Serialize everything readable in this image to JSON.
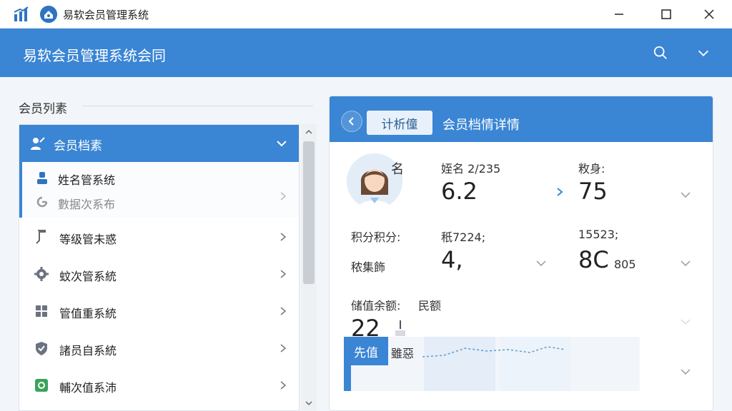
{
  "window": {
    "title": "易软会员管理系统"
  },
  "header": {
    "brand": "易软会员管理系统会同"
  },
  "sidebar": {
    "section_title": "会员列素",
    "group": {
      "label": "会员档素"
    },
    "sub_items": [
      {
        "label": "姓名管系统"
      },
      {
        "label": "數据次系布"
      }
    ],
    "items": [
      {
        "label": "等级管未惑"
      },
      {
        "label": "蚊次管系統"
      },
      {
        "label": "管值重系統"
      },
      {
        "label": "諸员自系統"
      },
      {
        "label": "輔次值系沛"
      }
    ]
  },
  "detail": {
    "tag": "计析僮",
    "title": "会员档情详情",
    "name_label": "名",
    "field1_label": "姪名 2/235",
    "field1_value": "6.2",
    "field2_label": "敉身:",
    "field2_value": "75",
    "points_label": "积分积分:",
    "points_label2": "秾集飾",
    "field3_label": "秖7224;",
    "field3_value": "4,",
    "field4_label": "15523;",
    "field4_value": "8C",
    "field4_suffix": "805",
    "balance_label": "储值余额:",
    "balance_label2": "民额",
    "balance_value": "22",
    "chart_tab": "先值",
    "chart_sub": "雖惡"
  },
  "colors": {
    "accent": "#3a85d4",
    "header": "#3a85d4"
  }
}
